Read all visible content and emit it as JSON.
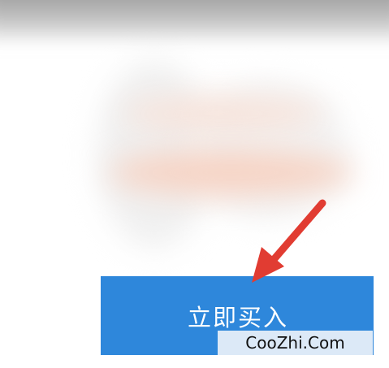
{
  "buy_button": {
    "label": "立即买入",
    "color": "#2e87db"
  },
  "watermark": {
    "text": "CooZhi.Com"
  },
  "annotation": {
    "icon": "red-arrow-icon",
    "color": "#e13c32"
  }
}
